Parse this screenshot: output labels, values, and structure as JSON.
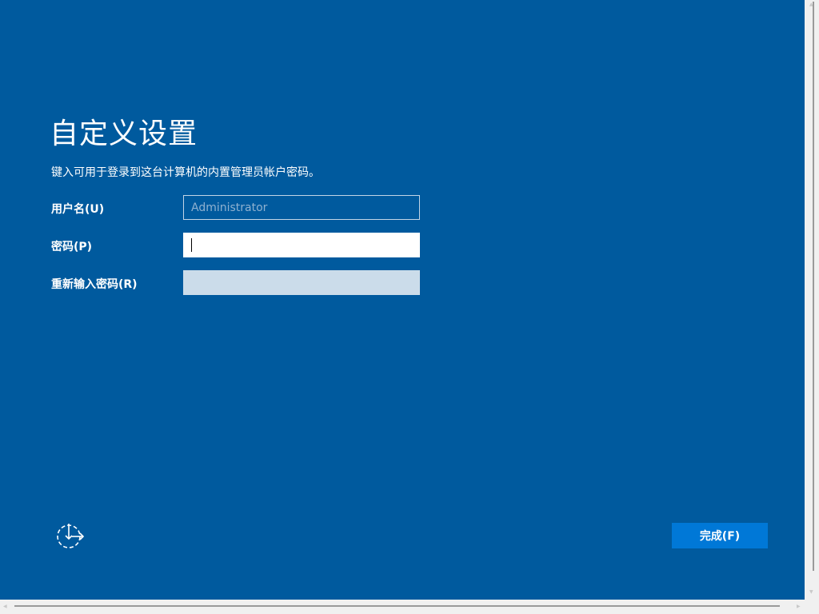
{
  "page": {
    "title": "自定义设置",
    "description": "键入可用于登录到这台计算机的内置管理员帐户密码。"
  },
  "form": {
    "username": {
      "label": "用户名(U)",
      "value": "Administrator"
    },
    "password": {
      "label": "密码(P)",
      "value": ""
    },
    "reenter_password": {
      "label": "重新输入密码(R)",
      "value": ""
    }
  },
  "footer": {
    "accessibility_icon": "ease-of-access-icon",
    "finish_label": "完成(F)"
  },
  "colors": {
    "background": "#005a9e",
    "accent_button": "#0078d7",
    "disabled_field": "#cbdcea",
    "text": "#ffffff"
  }
}
